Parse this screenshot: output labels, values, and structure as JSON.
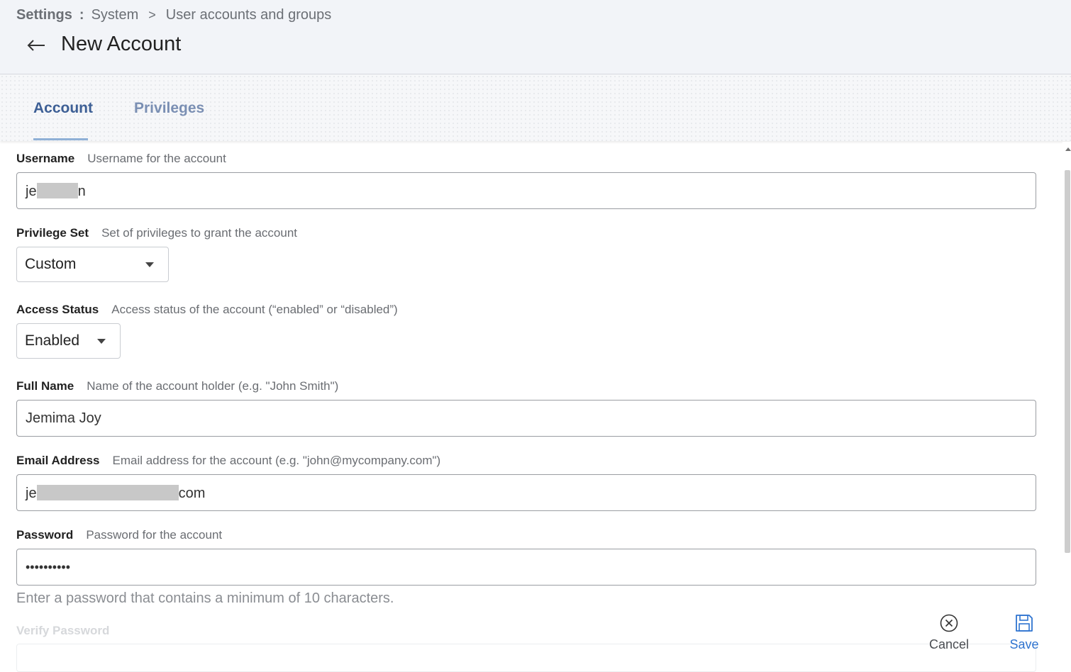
{
  "breadcrumb": {
    "root": "Settings",
    "colon": ":",
    "items": [
      "System",
      "User accounts and groups"
    ],
    "separator": ">"
  },
  "page": {
    "title": "New Account",
    "back_icon": "arrow-left-icon"
  },
  "tabs": [
    {
      "label": "Account",
      "active": true
    },
    {
      "label": "Privileges",
      "active": false
    }
  ],
  "form": {
    "username": {
      "label": "Username",
      "description": "Username for the account",
      "value_prefix": "je",
      "value_suffix": "n",
      "redacted": true
    },
    "privilege_set": {
      "label": "Privilege Set",
      "description": "Set of privileges to grant the account",
      "value": "Custom"
    },
    "access_status": {
      "label": "Access Status",
      "description": "Access status of the account (“enabled” or “disabled”)",
      "value": "Enabled"
    },
    "full_name": {
      "label": "Full Name",
      "description": "Name of the account holder (e.g. \"John Smith\")",
      "value": "Jemima Joy"
    },
    "email": {
      "label": "Email Address",
      "description": "Email address for the account (e.g. \"john@mycompany.com\")",
      "value_prefix": "je",
      "value_suffix": "com",
      "redacted": true
    },
    "password": {
      "label": "Password",
      "description": "Password for the account",
      "value": "••••••••••",
      "hint": "Enter a password that contains a minimum of 10 characters."
    },
    "verify_password": {
      "label": "Verify Password"
    }
  },
  "actions": {
    "cancel": {
      "label": "Cancel",
      "icon": "close-circle-icon"
    },
    "save": {
      "label": "Save",
      "icon": "save-disk-icon"
    }
  },
  "colors": {
    "accent": "#2f74d0",
    "tab_active": "#3d5f95",
    "tab_inactive": "#7a8fb3",
    "header_bg": "#f2f4f8"
  }
}
